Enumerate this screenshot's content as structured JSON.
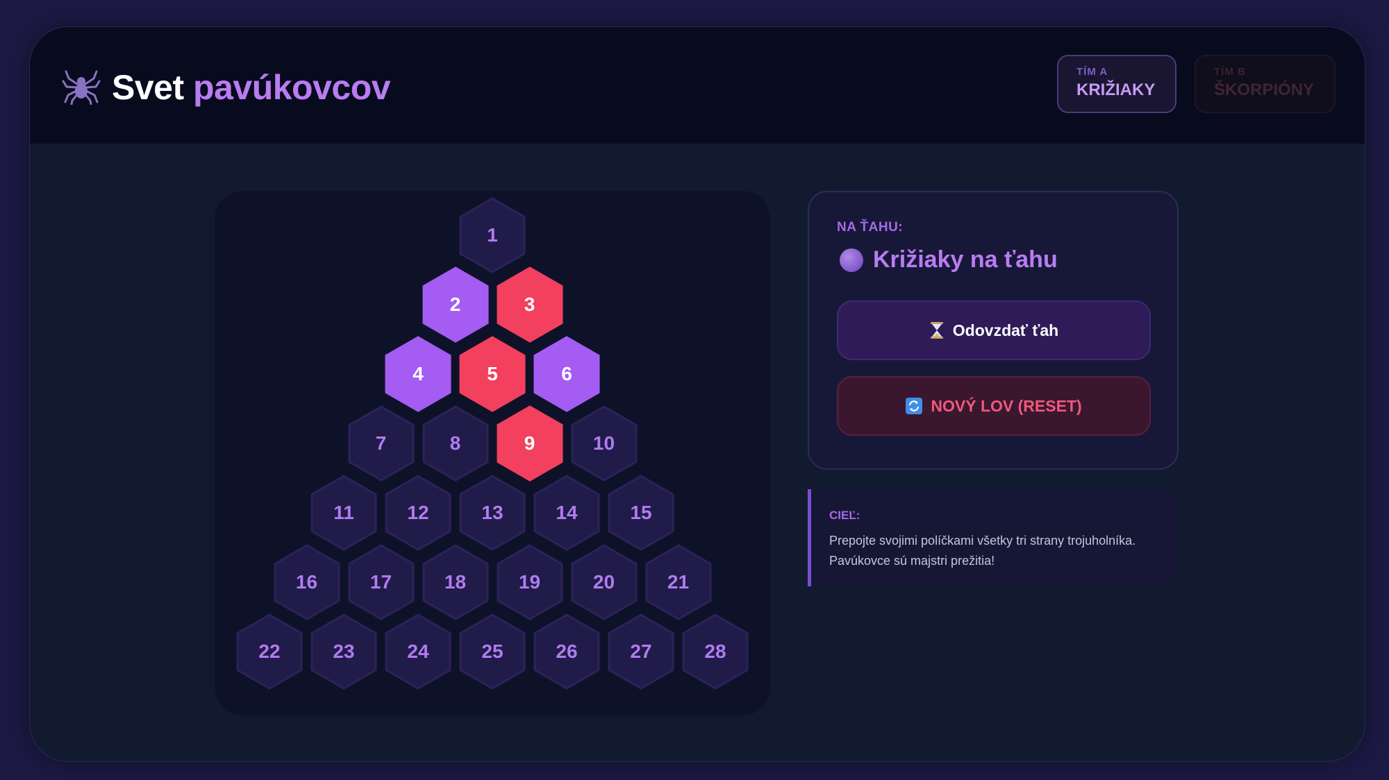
{
  "header": {
    "icon": "spider-icon",
    "title_part1": "Svet",
    "title_part2": "pavúkovcov",
    "team_a": {
      "small": "TÍM A",
      "name": "KRIŽIAKY"
    },
    "team_b": {
      "small": "TÍM B",
      "name": "ŠKORPIÓNY"
    }
  },
  "board": {
    "rows": 7,
    "cells": [
      {
        "n": "1",
        "state": "empty"
      },
      {
        "n": "2",
        "state": "purple"
      },
      {
        "n": "3",
        "state": "red"
      },
      {
        "n": "4",
        "state": "purple"
      },
      {
        "n": "5",
        "state": "red"
      },
      {
        "n": "6",
        "state": "purple"
      },
      {
        "n": "7",
        "state": "empty"
      },
      {
        "n": "8",
        "state": "empty"
      },
      {
        "n": "9",
        "state": "red"
      },
      {
        "n": "10",
        "state": "empty"
      },
      {
        "n": "11",
        "state": "empty"
      },
      {
        "n": "12",
        "state": "empty"
      },
      {
        "n": "13",
        "state": "empty"
      },
      {
        "n": "14",
        "state": "empty"
      },
      {
        "n": "15",
        "state": "empty"
      },
      {
        "n": "16",
        "state": "empty"
      },
      {
        "n": "17",
        "state": "empty"
      },
      {
        "n": "18",
        "state": "empty"
      },
      {
        "n": "19",
        "state": "empty"
      },
      {
        "n": "20",
        "state": "empty"
      },
      {
        "n": "21",
        "state": "empty"
      },
      {
        "n": "22",
        "state": "empty"
      },
      {
        "n": "23",
        "state": "empty"
      },
      {
        "n": "24",
        "state": "empty"
      },
      {
        "n": "25",
        "state": "empty"
      },
      {
        "n": "26",
        "state": "empty"
      },
      {
        "n": "27",
        "state": "empty"
      },
      {
        "n": "28",
        "state": "empty"
      }
    ]
  },
  "colors": {
    "purple": "#a55cf2",
    "red": "#f2405e",
    "empty": "#211b4a",
    "empty_stroke": "#2a2358"
  },
  "panel": {
    "turn_label": "NA ŤAHU:",
    "turn_text": "Križiaky na ťahu",
    "pass_button": "Odovzdať ťah",
    "pass_icon": "hourglass-icon",
    "reset_button": "NOVÝ LOV (RESET)",
    "reset_icon": "refresh-icon"
  },
  "goal": {
    "label": "CIEĽ:",
    "text": "Prepojte svojimi políčkami všetky tri strany trojuholníka. Pavúkovce sú majstri prežitia!"
  }
}
